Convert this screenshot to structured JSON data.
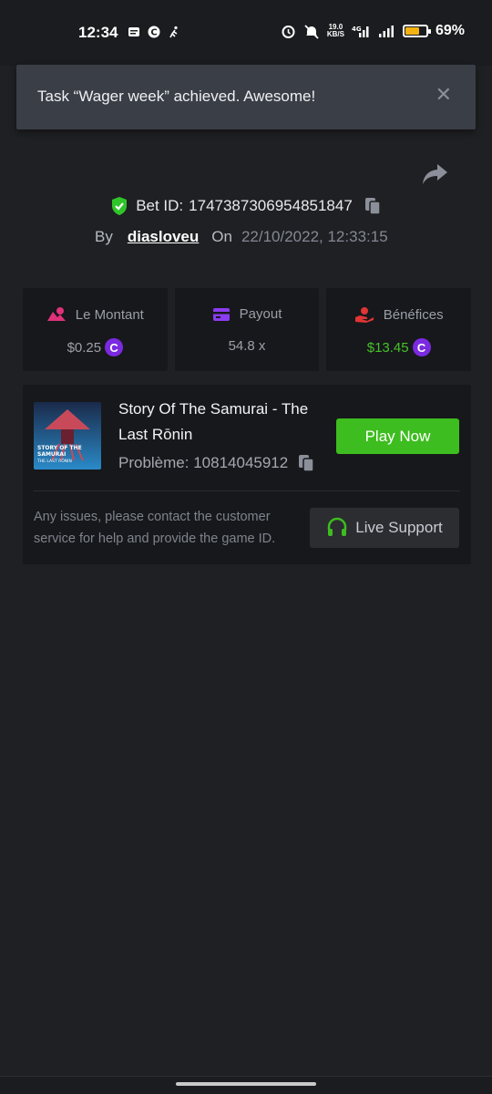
{
  "status_bar": {
    "time": "12:34",
    "speed_value": "19.0",
    "speed_unit": "KB/S",
    "network": "4G",
    "battery_percent": "69%",
    "battery_level": 0.69
  },
  "toast": {
    "message": "Task “Wager week” achieved. Awesome!",
    "close_glyph": "✕"
  },
  "bet": {
    "id_label": "Bet ID:",
    "id_value": "1747387306954851847",
    "by_label": "By",
    "username": "diasloveu",
    "on_label": "On",
    "datetime": "22/10/2022, 12:33:15"
  },
  "stats": [
    {
      "label": "Le Montant",
      "value": "$0.25",
      "icon": "amount-icon",
      "has_coin": true
    },
    {
      "label": "Payout",
      "value": "54.8 x",
      "icon": "payout-card-icon",
      "has_coin": false
    },
    {
      "label": "Bénéfices",
      "value": "$13.45",
      "icon": "profit-hand-icon",
      "has_coin": true
    }
  ],
  "game": {
    "title": "Story Of The Samurai - The Last Rōnin",
    "problem_label": "Problème:",
    "problem_id": "10814045912",
    "play_label": "Play Now",
    "thumb_text_line1": "STORY OF THE",
    "thumb_text_line2": "SAMURAI",
    "thumb_text_line3": "THE LAST RŌNIN",
    "issues_text": "Any issues, please contact the customer service for help and provide the game ID.",
    "support_label": "Live Support"
  },
  "colors": {
    "background": "#1f2023",
    "card": "#17181b",
    "toast": "#3a3e46",
    "green": "#3dbd1f",
    "profit_green": "#45c32a",
    "coin_purple": "#7a2ae0",
    "accent_pink": "#e0317a",
    "accent_purple": "#8b3cf0",
    "accent_red": "#e03535"
  },
  "currency_glyph": "C"
}
